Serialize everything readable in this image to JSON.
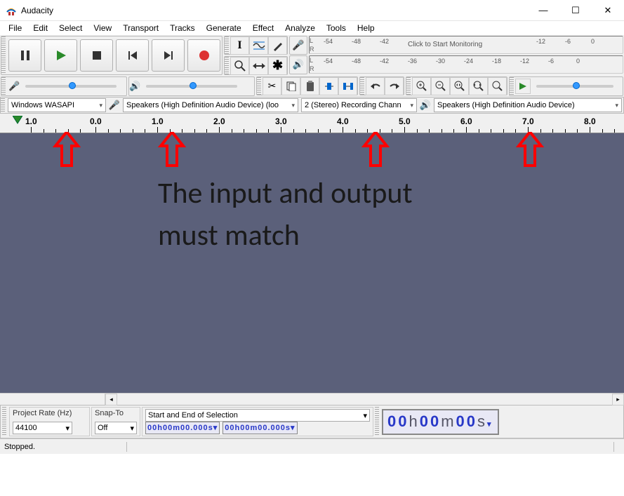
{
  "window": {
    "title": "Audacity"
  },
  "menubar": [
    "File",
    "Edit",
    "Select",
    "View",
    "Transport",
    "Tracks",
    "Generate",
    "Effect",
    "Analyze",
    "Tools",
    "Help"
  ],
  "meter": {
    "ticks": [
      "-54",
      "-48",
      "-42",
      "-36",
      "-30",
      "-24",
      "-18",
      "-12",
      "-6",
      "0"
    ],
    "rec_prompt": "Click to Start Monitoring",
    "labels": {
      "left": "L",
      "right": "R"
    }
  },
  "devices": {
    "host": "Windows WASAPI",
    "rec_device": "Speakers (High Definition Audio Device) (loo",
    "rec_channels": "2 (Stereo) Recording Chann",
    "play_device": "Speakers (High Definition Audio Device)"
  },
  "ruler": {
    "ticks": [
      {
        "pos": 36,
        "label": "1.0",
        "neg": true
      },
      {
        "pos": 128,
        "label": "0.0"
      },
      {
        "pos": 216,
        "label": "1.0"
      },
      {
        "pos": 304,
        "label": "2.0"
      },
      {
        "pos": 392,
        "label": "3.0"
      },
      {
        "pos": 480,
        "label": "4.0"
      },
      {
        "pos": 568,
        "label": "5.0"
      },
      {
        "pos": 656,
        "label": "6.0"
      },
      {
        "pos": 744,
        "label": "7.0"
      },
      {
        "pos": 832,
        "label": "8.0"
      }
    ]
  },
  "overlay": {
    "line1": "The input and output",
    "line2": "must match"
  },
  "selection": {
    "project_rate_label": "Project Rate (Hz)",
    "project_rate": "44100",
    "snap_label": "Snap-To",
    "snap": "Off",
    "range_label": "Start and End of Selection",
    "start": "00h00m00.000s",
    "end": "00h00m00.000s",
    "position": "00h00m00s"
  },
  "status": {
    "text": "Stopped."
  }
}
